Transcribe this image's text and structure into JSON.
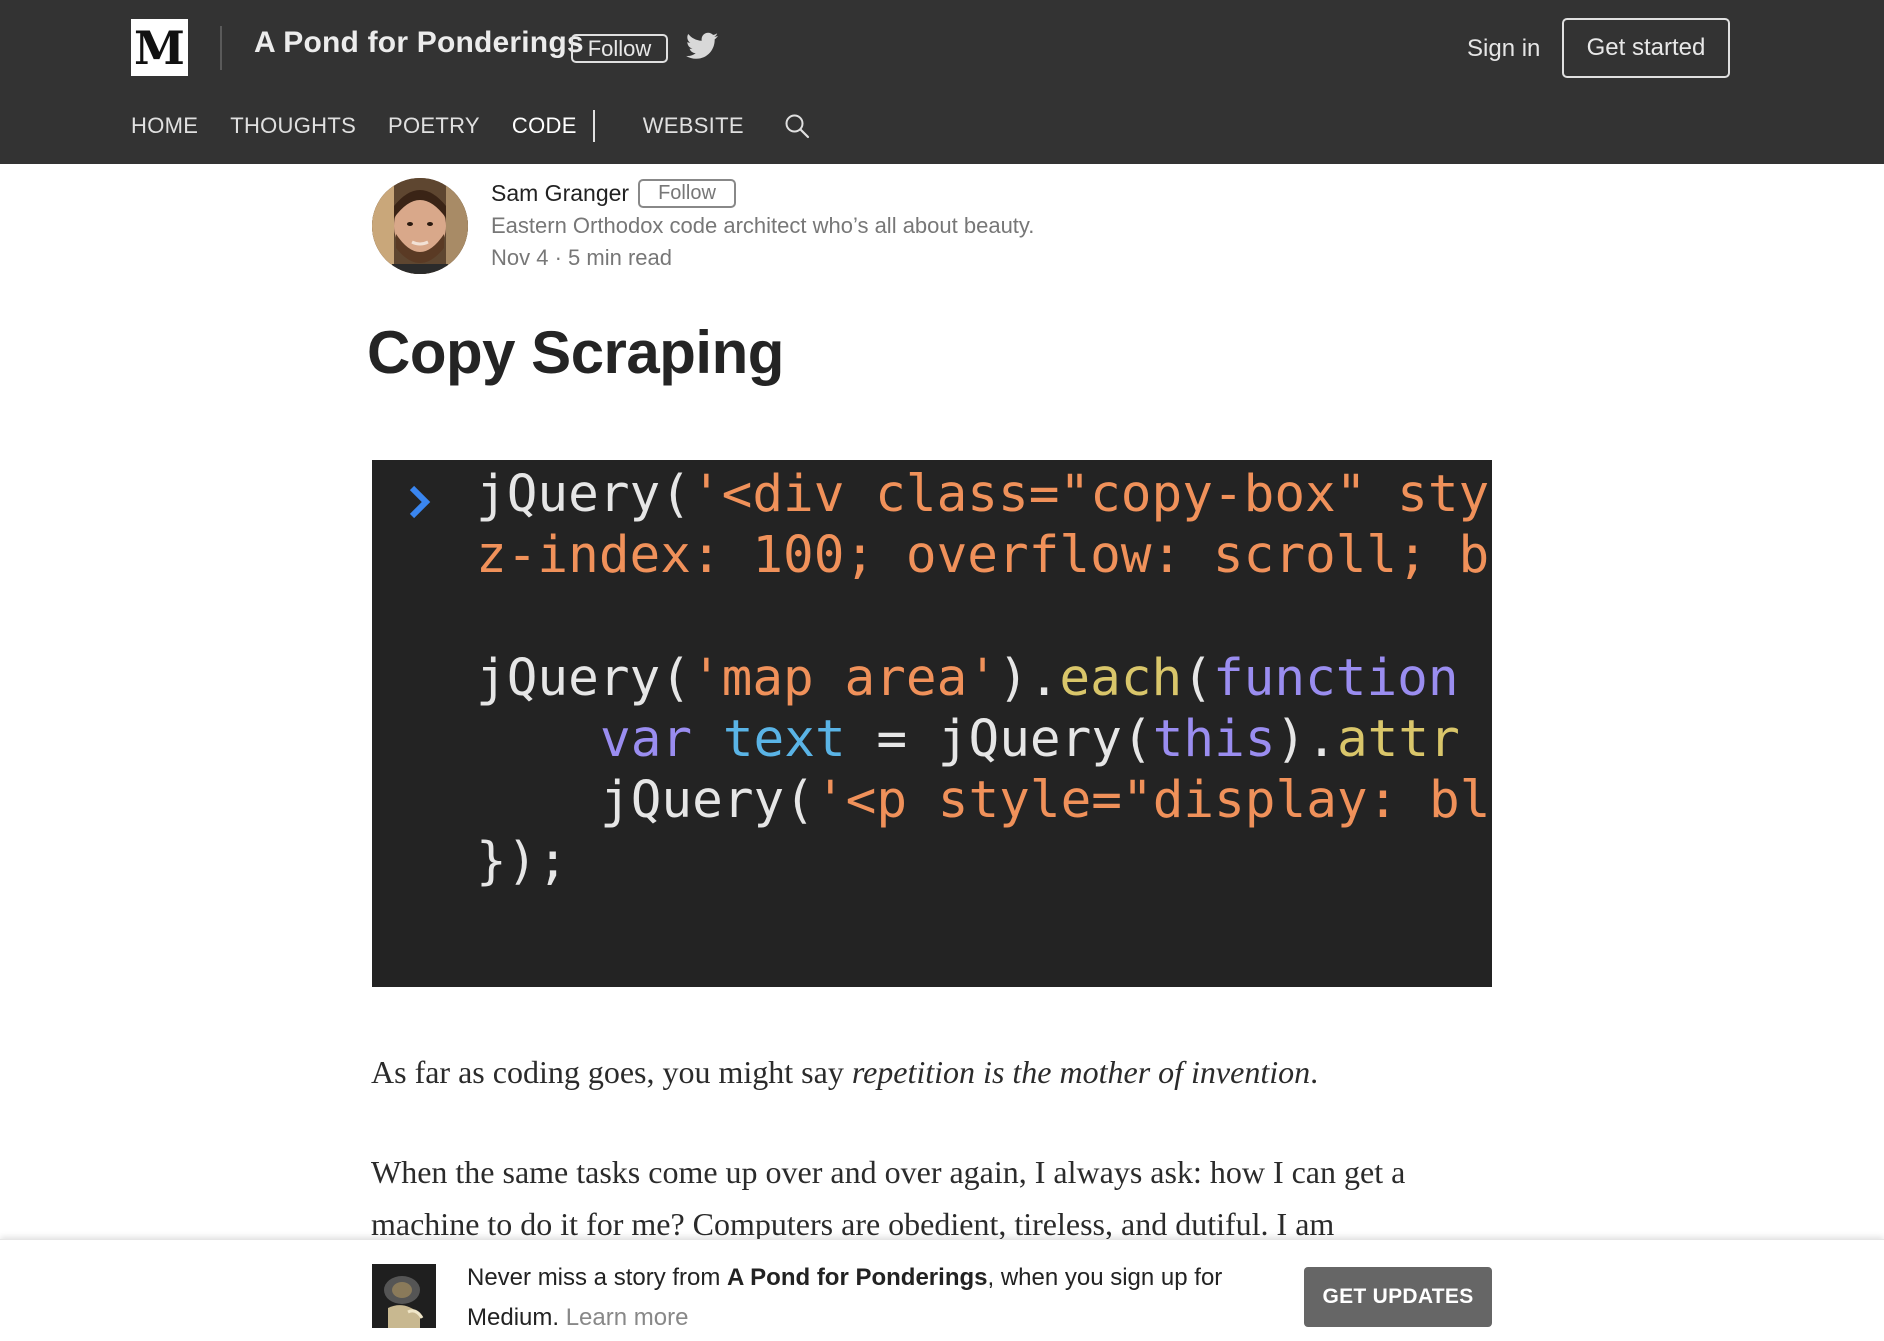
{
  "header": {
    "logo": "M",
    "publication": "A Pond for Ponderings",
    "follow_label": "Follow",
    "signin_label": "Sign in",
    "get_started_label": "Get started",
    "icons": [
      "twitter-icon",
      "search-icon"
    ]
  },
  "nav": {
    "items": [
      "HOME",
      "THOUGHTS",
      "POETRY",
      "CODE",
      "WEBSITE"
    ],
    "active": "CODE"
  },
  "author": {
    "name": "Sam Granger",
    "follow_label": "Follow",
    "bio": "Eastern Orthodox code architect who’s all about beauty.",
    "date": "Nov 4",
    "separator": " · ",
    "read_time": "5 min read"
  },
  "article": {
    "title": "Copy Scraping",
    "code_lines": [
      [
        "jQuery(",
        "'<div class=\"copy-box\" sty"
      ],
      [
        "z-index: 100; overflow: scroll; b"
      ],
      [
        "jQuery(",
        "'map area'",
        ").",
        "each",
        "(",
        "function"
      ],
      [
        "var",
        " ",
        "text",
        " = jQuery(",
        "this",
        ").",
        "attr"
      ],
      [
        "jQuery(",
        "'<p style=\"display: bl"
      ],
      [
        "});"
      ]
    ],
    "para1_before": "As far as coding goes, you might say ",
    "para1_em": "repetition is the mother of invention",
    "para1_after": ".",
    "para2": "When the same tasks come up over and over again, I always ask: how I can get a machine to do it for me? Computers are obedient, tireless, and dutiful. I am"
  },
  "banner": {
    "text_before": "Never miss a story from ",
    "publication": "A Pond for Ponderings",
    "text_after": ", when you sign up for Medium. ",
    "learn_more": "Learn more",
    "button_label": "GET UPDATES"
  },
  "colors": {
    "topbar": "#333333",
    "code_bg": "#232323",
    "string": "#f0915a",
    "keyword": "#9a8df0",
    "variable": "#5ab4e6",
    "method": "#d9c66a",
    "button": "#666666"
  }
}
